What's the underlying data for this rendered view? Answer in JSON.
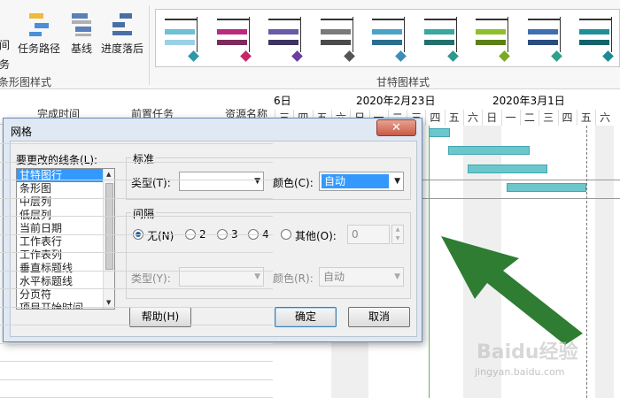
{
  "ribbon": {
    "partial_button": "间\n务",
    "buttons": [
      {
        "label": "任务路径"
      },
      {
        "label": "基线"
      },
      {
        "label": "进度落后"
      }
    ],
    "group_left_label": "条形图样式",
    "group_gallery_label": "甘特图样式"
  },
  "gallery_styles": [
    {
      "c1": "#b92a80",
      "c2": "#e36fb4",
      "c3": "#7d2a5c",
      "dm": "#c8286b"
    },
    {
      "c1": "#6b58a8",
      "c2": "#a28fd2",
      "c3": "#3e3462",
      "dm": "#6b3fa0"
    },
    {
      "c1": "#7a7a7a",
      "c2": "#b3b3b3",
      "c3": "#4b4b4b",
      "dm": "#555555"
    },
    {
      "c1": "#4aa3c9",
      "c2": "#8fd0ea",
      "c3": "#2b6f8e",
      "dm": "#3d8fb8"
    },
    {
      "c1": "#39a89e",
      "c2": "#7dd3ca",
      "c3": "#23706a",
      "dm": "#2e9990"
    },
    {
      "c1": "#8fbf2d",
      "c2": "#c2e07c",
      "c3": "#5c8017",
      "dm": "#7aaa22"
    },
    {
      "c1": "#3f6fb2",
      "c2": "#7fa7dd",
      "c3": "#2a4c7f",
      "dm": "#2fa08e"
    },
    {
      "c1": "#1f8f9a",
      "c2": "#6fc9d1",
      "c3": "#14626a",
      "dm": "#1c8a94"
    }
  ],
  "table": {
    "col_finish": "完成时间",
    "col_predecessor": "前置任务",
    "col_resource": "资源名称"
  },
  "timeline": {
    "week_labels": [
      "6日",
      "2020年2月23日",
      "2020年3月1日"
    ],
    "days": [
      "三",
      "四",
      "五",
      "六",
      "日",
      "一",
      "二",
      "三",
      "四",
      "五",
      "六",
      "日",
      "一",
      "二",
      "三",
      "四",
      "五",
      "六"
    ]
  },
  "dialog": {
    "title": "网格",
    "close_label": "✕",
    "line_to_change_label": "要更改的线条(L):",
    "lines": [
      "甘特图行",
      "条形图",
      "中层列",
      "低层列",
      "当前日期",
      "工作表行",
      "工作表列",
      "垂直标题线",
      "水平标题线",
      "分页符",
      "项目开始时间"
    ],
    "standard_group": "标准",
    "type_label": "类型(T):",
    "type_value": "",
    "color_label": "颜色(C):",
    "color_value": "自动",
    "interval_group": "间隔",
    "interval_none": "无(N)",
    "interval_2": "2",
    "interval_3": "3",
    "interval_4": "4",
    "interval_other": "其他(O):",
    "interval_other_value": "0",
    "interval_type_label": "类型(Y):",
    "interval_type_value": "",
    "interval_color_label": "颜色(R):",
    "interval_color_value": "自动",
    "help_button": "帮助(H)",
    "ok_button": "确定",
    "cancel_button": "取消"
  },
  "watermark": {
    "text": "Baidu经验",
    "sub": "jingyan.baidu.com"
  },
  "colors": {
    "accent_bar": "#6cc6cc",
    "arrow": "#2e7d32",
    "selection": "#3399ff"
  }
}
